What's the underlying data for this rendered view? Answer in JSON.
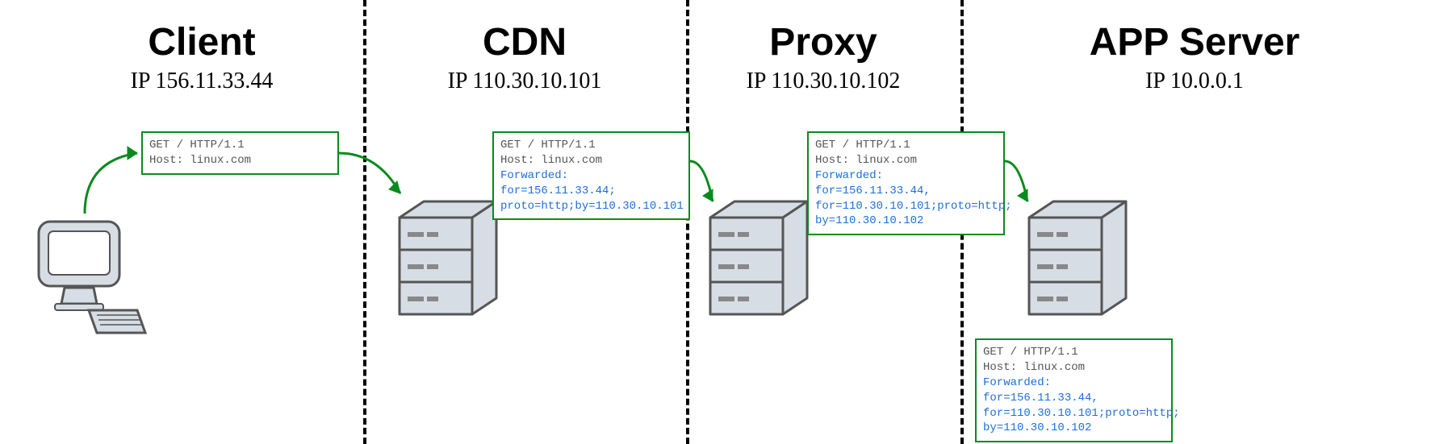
{
  "sections": {
    "client": {
      "title": "Client",
      "ip": "IP 156.11.33.44"
    },
    "cdn": {
      "title": "CDN",
      "ip": "IP 110.30.10.101"
    },
    "proxy": {
      "title": "Proxy",
      "ip": "IP 110.30.10.102"
    },
    "app": {
      "title": "APP Server",
      "ip": "IP 10.0.0.1"
    }
  },
  "requests": {
    "client_out": {
      "line1": "GET /  HTTP/1.1",
      "line2": "Host: linux.com"
    },
    "cdn_out": {
      "line1": "GET /  HTTP/1.1",
      "line2": "Host: linux.com",
      "fw1": "Forwarded: for=156.11.33.44;",
      "fw2": "proto=http;by=110.30.10.101"
    },
    "proxy_out": {
      "line1": "GET /  HTTP/1.1",
      "line2": "Host: linux.com",
      "fw1": "Forwarded: for=156.11.33.44,",
      "fw2": "for=110.30.10.101;proto=http;",
      "fw3": "by=110.30.10.102"
    },
    "app_recv": {
      "line1": "GET /  HTTP/1.1",
      "line2": "Host: linux.com",
      "fw1": "Forwarded: for=156.11.33.44,",
      "fw2": "for=110.30.10.101;proto=http;",
      "fw3": "by=110.30.10.102"
    }
  }
}
